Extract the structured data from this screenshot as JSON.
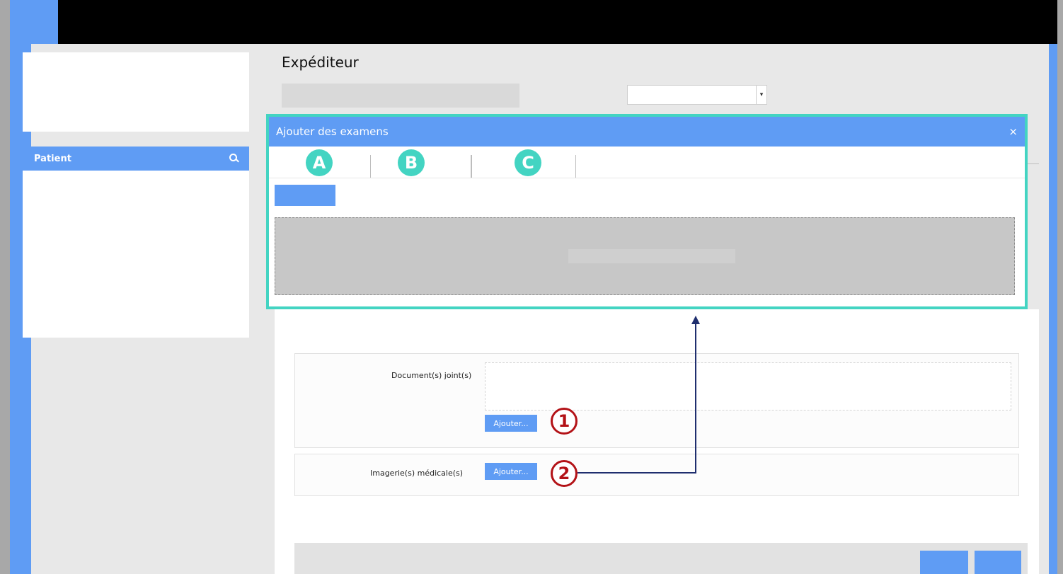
{
  "sender": {
    "title": "Expéditeur"
  },
  "sidebar": {
    "patient_label": "Patient",
    "search_icon": "search-icon"
  },
  "modal": {
    "title": "Ajouter des examens",
    "close_symbol": "×",
    "tabs": [
      {
        "marker": "A"
      },
      {
        "marker": "B"
      },
      {
        "marker": "C"
      }
    ]
  },
  "form": {
    "documents_label": "Document(s) joint(s)",
    "documents_add_button": "Ajouter...",
    "imaging_label": "Imagerie(s) médicale(s)",
    "imaging_add_button": "Ajouter..."
  },
  "annotations": {
    "badge_1": "1",
    "badge_2": "2"
  },
  "colors": {
    "accent": "#5f9cf4",
    "highlight": "#43d4c2",
    "badge": "#b31217",
    "arrow": "#1f2e6e"
  }
}
